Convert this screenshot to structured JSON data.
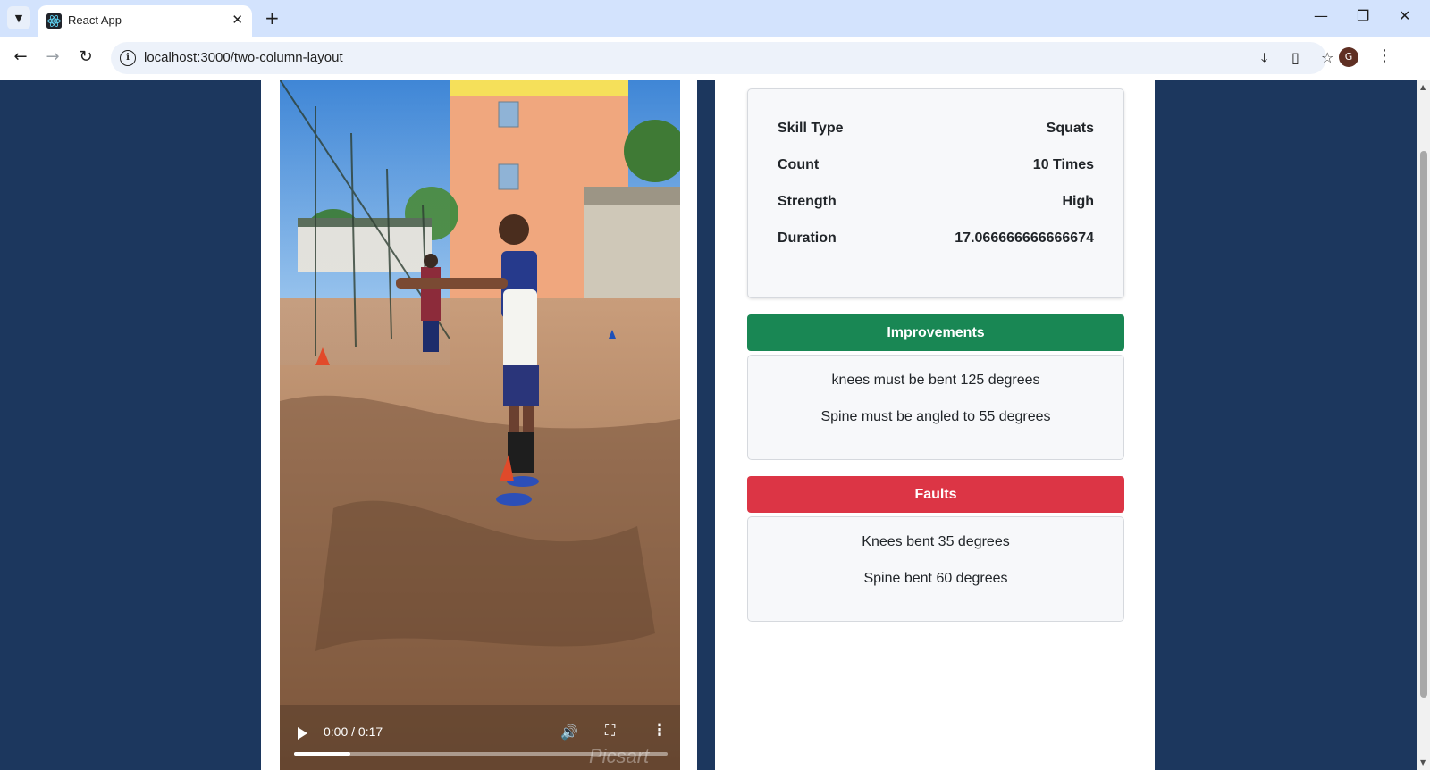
{
  "browser": {
    "tab_title": "React App",
    "tab_close": "✕",
    "new_tab": "+",
    "url": "localhost:3000/two-column-layout",
    "profile_initial": "G",
    "window_controls": {
      "minimize": "—",
      "restore": "❐",
      "close": "✕"
    },
    "icons": [
      "tab-list-icon",
      "react-favicon-icon",
      "back-icon",
      "forward-icon",
      "reload-icon",
      "info-icon",
      "install-icon",
      "reading-mode-icon",
      "bookmark-star-icon",
      "menu-icon"
    ]
  },
  "video": {
    "time": "0:00 / 0:17",
    "progress": 0.15,
    "watermark": "Picsart"
  },
  "stats": [
    {
      "label": "Skill Type",
      "value": "Squats"
    },
    {
      "label": "Count",
      "value": "10 Times"
    },
    {
      "label": "Strength",
      "value": "High"
    },
    {
      "label": "Duration",
      "value": "17.066666666666674"
    }
  ],
  "improvements": {
    "title": "Improvements",
    "items": [
      "knees must be bent 125 degrees",
      "Spine must be angled to 55 degrees"
    ]
  },
  "faults": {
    "title": "Faults",
    "items": [
      "Knees bent 35 degrees",
      "Spine bent 60 degrees"
    ]
  },
  "colors": {
    "page_bg": "#1c375e",
    "improvements": "#198754",
    "faults": "#dc3545"
  }
}
